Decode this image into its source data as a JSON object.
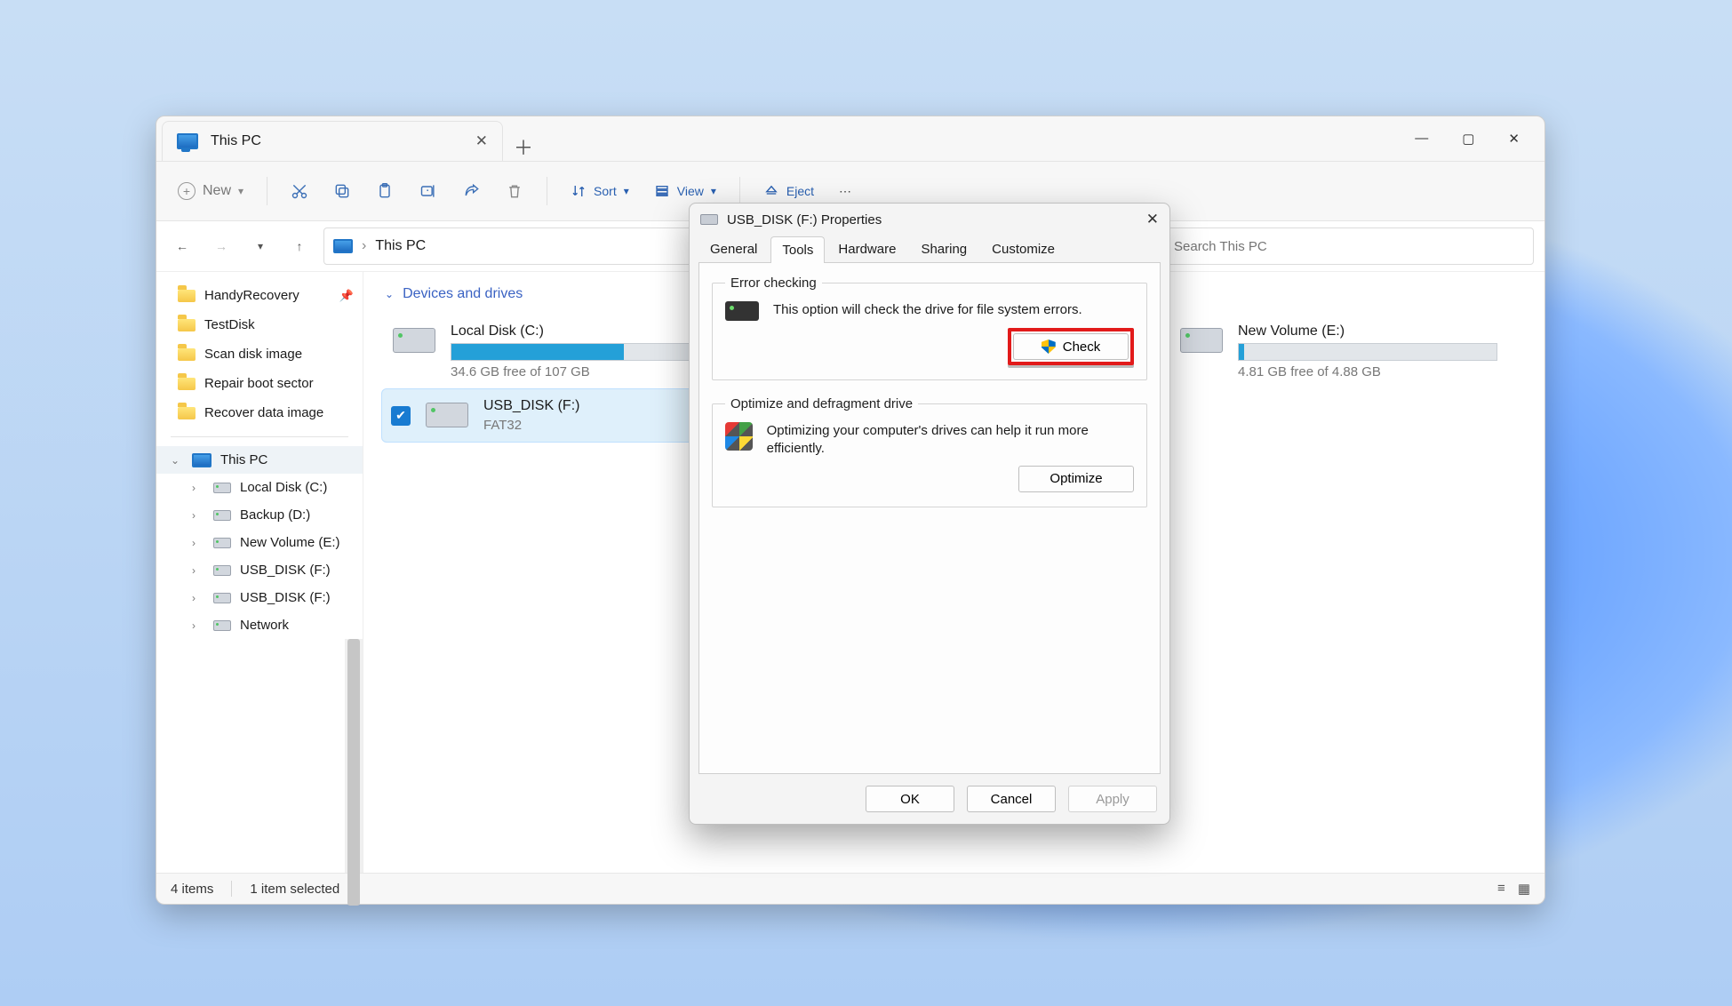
{
  "explorer": {
    "tab_title": "This PC",
    "new_label": "New",
    "toolbar": {
      "sort": "Sort",
      "view": "View",
      "eject": "Eject"
    },
    "breadcrumb": "This PC",
    "search_placeholder": "Search This PC",
    "quick_access": [
      {
        "label": "HandyRecovery",
        "pinned": true
      },
      {
        "label": "TestDisk"
      },
      {
        "label": "Scan disk image"
      },
      {
        "label": "Repair boot sector"
      },
      {
        "label": "Recover data image"
      }
    ],
    "this_pc_label": "This PC",
    "tree": [
      {
        "label": "Local Disk (C:)"
      },
      {
        "label": "Backup (D:)"
      },
      {
        "label": "New Volume (E:)"
      },
      {
        "label": "USB_DISK (F:)"
      },
      {
        "label": "USB_DISK (F:)"
      },
      {
        "label": "Network"
      }
    ],
    "section": "Devices and drives",
    "drives": [
      {
        "name": "Local Disk (C:)",
        "sub": "34.6 GB free of 107 GB",
        "fill": 67
      },
      {
        "name": "USB_DISK (F:)",
        "sub": "FAT32",
        "fill": 0,
        "selected": true
      },
      {
        "name": "New Volume (E:)",
        "sub": "4.81 GB free of 4.88 GB",
        "fill": 2,
        "col3": true
      }
    ],
    "status_items": "4 items",
    "status_sel": "1 item selected"
  },
  "dialog": {
    "title": "USB_DISK (F:) Properties",
    "tabs": [
      "General",
      "Tools",
      "Hardware",
      "Sharing",
      "Customize"
    ],
    "active_tab": "Tools",
    "error_checking": {
      "legend": "Error checking",
      "text": "This option will check the drive for file system errors.",
      "button": "Check"
    },
    "defrag": {
      "legend": "Optimize and defragment drive",
      "text": "Optimizing your computer's drives can help it run more efficiently.",
      "button": "Optimize"
    },
    "ok": "OK",
    "cancel": "Cancel",
    "apply": "Apply"
  }
}
